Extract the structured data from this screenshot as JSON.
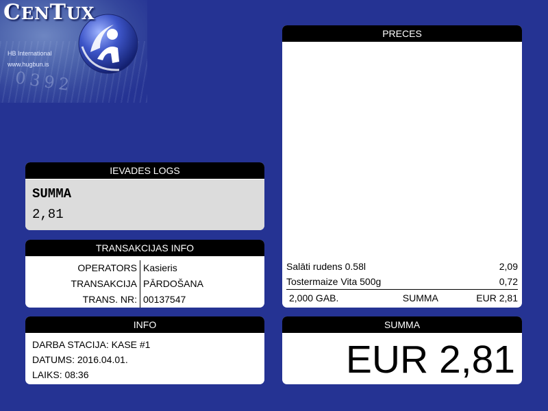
{
  "logo": {
    "title_first": "C",
    "title_rest": "EN",
    "title_t": "T",
    "title_end": "UX",
    "company": "HB International",
    "url": "www.hugbun.is",
    "digits": "0392"
  },
  "input_panel": {
    "title": "IEVADES LOGS",
    "label": "SUMMA",
    "value": "2,81"
  },
  "transaction_panel": {
    "title": "TRANSAKCIJAS INFO",
    "rows": [
      {
        "key": "OPERATORS",
        "value": "Kasieris"
      },
      {
        "key": "TRANSAKCIJA",
        "value": "PĀRDOŠANA"
      },
      {
        "key": "TRANS. NR:",
        "value": "00137547"
      }
    ]
  },
  "info_panel": {
    "title": "INFO",
    "lines": [
      "DARBA STACIJA: KASE #1",
      "DATUMS: 2016.04.01.",
      "LAIKS: 08:36"
    ]
  },
  "goods_panel": {
    "title": "PRECES",
    "items": [
      {
        "name": "Salāti rudens 0.58l",
        "price": "2,09"
      },
      {
        "name": "Tostermaize Vita 500g",
        "price": "0,72"
      }
    ],
    "footer": {
      "count": "2,000 GAB.",
      "label": "SUMMA",
      "total": "EUR 2,81"
    }
  },
  "total_panel": {
    "title": "SUMMA",
    "value": "EUR 2,81"
  },
  "colors": {
    "background": "#253393",
    "header": "#000000",
    "input_background": "#dcdcdc"
  }
}
